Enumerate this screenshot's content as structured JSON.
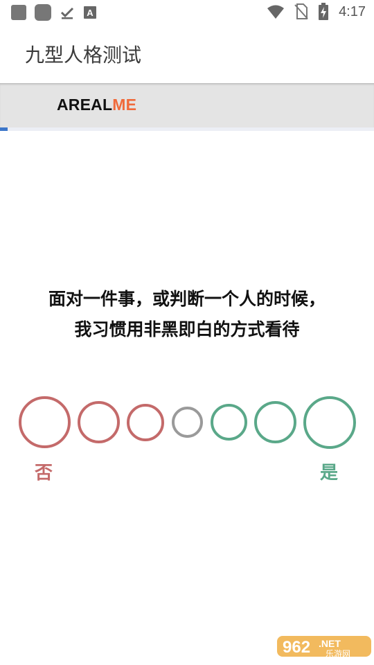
{
  "status_bar": {
    "time": "4:17",
    "icons": [
      "notification-square-icon",
      "app-square-icon",
      "download-done-icon",
      "text-a-icon",
      "wifi-icon",
      "no-sim-icon",
      "battery-charging-icon"
    ]
  },
  "app_bar": {
    "title": "九型人格测试"
  },
  "brand": {
    "part1": "AREAL",
    "part2": "ME"
  },
  "progress": {
    "value": 0.02
  },
  "question": {
    "line1": "面对一件事，或判断一个人的时候，",
    "line2": "我习惯用非黑即白的方式看待"
  },
  "scale": {
    "no_label": "否",
    "yes_label": "是",
    "options": 7
  },
  "colors": {
    "no": "#c46a6a",
    "neutral": "#9a9a9a",
    "yes": "#5aa889",
    "brand_accent": "#f06a3b",
    "progress": "#3c76c9"
  },
  "watermark": {
    "text": "962.NET",
    "subtext": "乐游网"
  }
}
